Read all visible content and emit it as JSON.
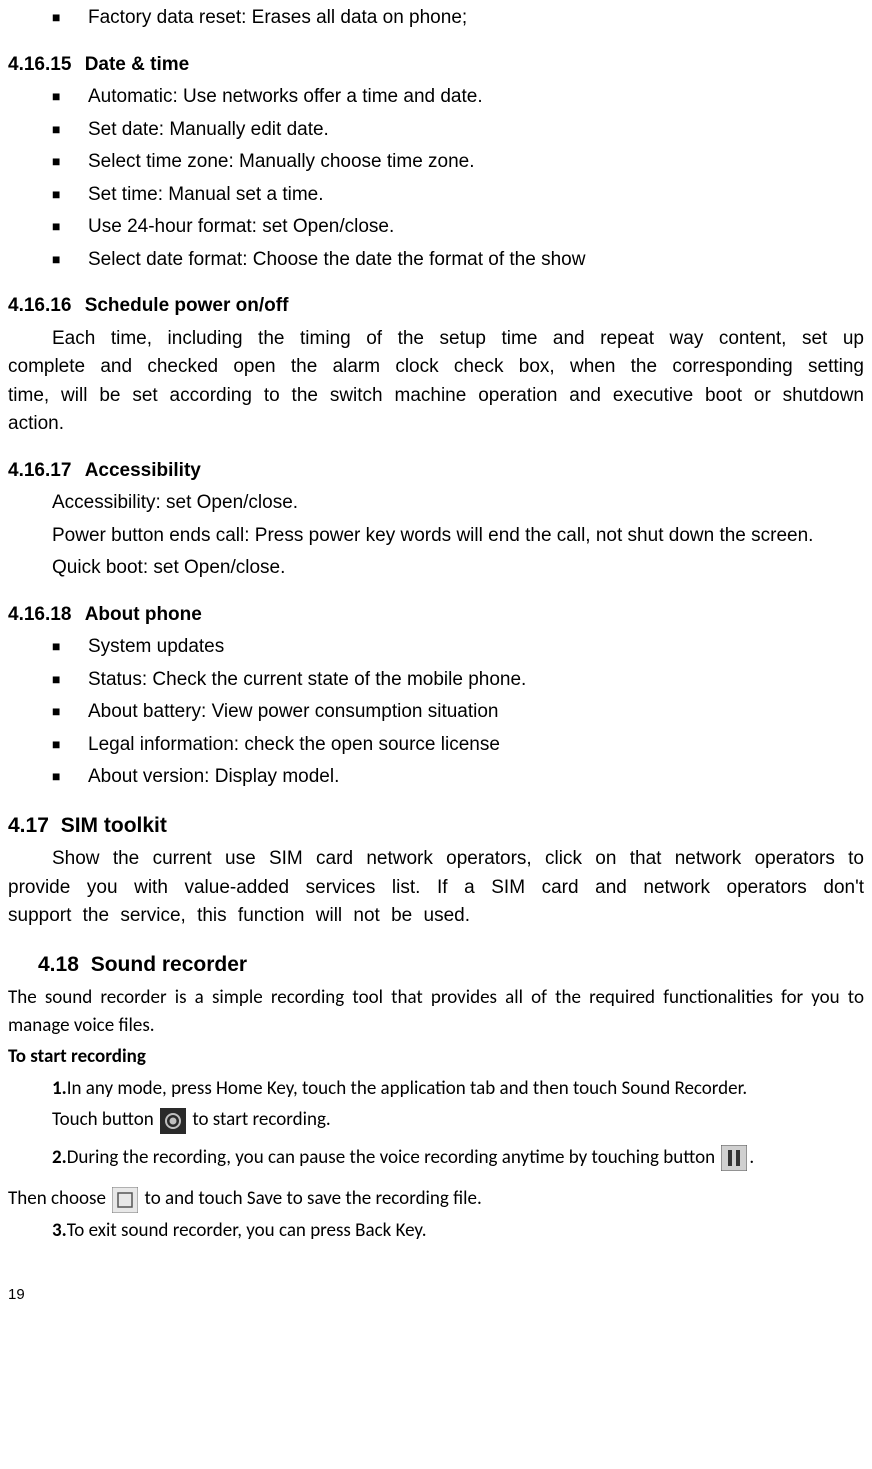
{
  "top_bullets": [
    "Factory data reset: Erases all data on phone;"
  ],
  "s15": {
    "num": "4.16.15",
    "title": "Date & time",
    "bullets": [
      "Automatic: Use networks offer a time and date.",
      "Set date: Manually edit date.",
      "Select time zone: Manually choose time zone.",
      "Set time: Manual set a time.",
      "Use 24-hour format: set Open/close.",
      "Select date format: Choose the date the format of the show"
    ]
  },
  "s16": {
    "num": "4.16.16",
    "title": "Schedule power on/off",
    "para": "Each time, including the timing of the setup time and repeat way content, set up complete and checked open the alarm clock check box, when the corresponding setting time, will be set according to the switch machine operation and executive boot or shutdown action."
  },
  "s17": {
    "num": "4.16.17",
    "title": "Accessibility",
    "p1": "Accessibility: set Open/close.",
    "p2": "Power button ends call: Press power key words will end the call, not shut down the screen.",
    "p3": "Quick boot: set Open/close."
  },
  "s18": {
    "num": "4.16.18",
    "title": "About phone",
    "bullets": [
      "System updates",
      "Status: Check the current state of the mobile phone.",
      "About battery: View power consumption situation",
      "Legal information: check the open source license",
      "About version: Display model."
    ]
  },
  "sim": {
    "num": "4.17",
    "title": "SIM toolkit",
    "para": "Show the current use SIM card network operators, click on that network operators to provide you with value-added services list. If a SIM card and network operators don't support the service, this function will not be used."
  },
  "sr": {
    "num": "4.18",
    "title": "Sound recorder",
    "intro": "The sound recorder is a simple recording tool that provides all of the required functionalities for you to manage voice files.",
    "start_heading": "To start recording",
    "step1_a": "1.",
    "step1_b": "In any mode, press Home Key, touch the application tab and then touch Sound Recorder.",
    "touch_a": "Touch button ",
    "touch_b": " to start recording.",
    "step2_a": "2.",
    "step2_b": "During the recording, you can pause the voice recording anytime by touching button",
    "step2_c": ".",
    "then_a": "Then choose ",
    "then_b": " to and touch Save to save the recording file.",
    "step3_a": "3.",
    "step3_b": "To exit sound recorder, you can press Back Key."
  },
  "page_number": "19"
}
